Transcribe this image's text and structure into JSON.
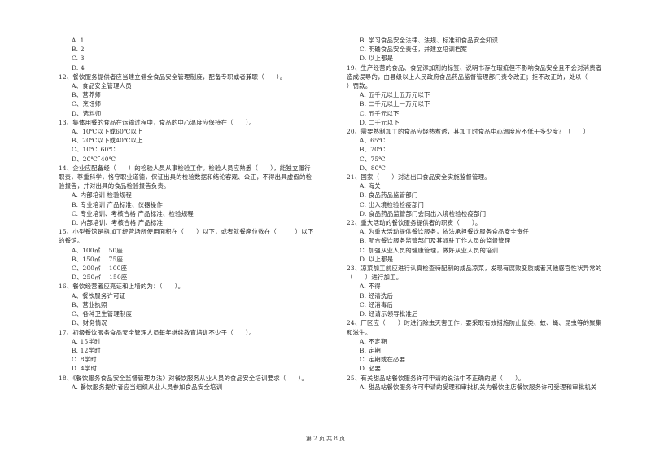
{
  "left_column": [
    {
      "type": "opt",
      "text": "A. 1"
    },
    {
      "type": "opt",
      "text": "B. 2"
    },
    {
      "type": "opt",
      "text": "C. 3"
    },
    {
      "type": "opt",
      "text": "D. 4"
    },
    {
      "type": "q",
      "text": "12、餐饮服务提供者应当建立健全食品安全管理制度，配备专职或者兼职（　　）。"
    },
    {
      "type": "opt",
      "text": "A、食品安全管理人员"
    },
    {
      "type": "opt",
      "text": "B、营养师"
    },
    {
      "type": "opt",
      "text": "C、烹饪师"
    },
    {
      "type": "opt",
      "text": "D、选料师"
    },
    {
      "type": "q",
      "text": "13、集体用餐的食品在运输过程中，食品的中心温度应保持在（　　）。"
    },
    {
      "type": "opt",
      "text": "A、10℃以下或60℃以上"
    },
    {
      "type": "opt",
      "text": "B、20℃以下或40℃以上"
    },
    {
      "type": "opt",
      "text": "C、10℃˜60℃"
    },
    {
      "type": "opt",
      "text": "D、20℃˜40℃"
    },
    {
      "type": "q",
      "text": "14、企业应配备经（　　）的检验人员从事检验工作。检验人员应熟悉（　　），能独立履行"
    },
    {
      "type": "q",
      "text": "职责，尊重科学，恪守职业道德，保证出具的检验数据和结论客观、公正，不得出具虚假的检"
    },
    {
      "type": "q",
      "text": "验报告，并对出具的食品检验报告负责。"
    },
    {
      "type": "opt",
      "text": "A. 内部培训  检验规程"
    },
    {
      "type": "opt",
      "text": "B. 专业培训  产品标准、仪器操作"
    },
    {
      "type": "opt",
      "text": "C. 专业培训、考核合格  产品标准、检验规程"
    },
    {
      "type": "opt",
      "text": "D. 内部培训、考核合格  产品标准"
    },
    {
      "type": "q",
      "text": "15、小型餐馆是指加工经营场所使用面积在（　　）以下，或者就餐座位数在（　　　）以下"
    },
    {
      "type": "q",
      "text": "的餐馆。"
    },
    {
      "type": "opt",
      "text": "A、100㎡　 50座"
    },
    {
      "type": "opt",
      "text": "B、150㎡　 75座"
    },
    {
      "type": "opt",
      "text": "C、200㎡　 100座"
    },
    {
      "type": "opt",
      "text": "D、250㎡　 150座"
    },
    {
      "type": "q",
      "text": "16、餐饮经营者应亮证和上墙的为：（　　）。"
    },
    {
      "type": "opt",
      "text": "A、餐饮服务许可证"
    },
    {
      "type": "opt",
      "text": "B、营业执照"
    },
    {
      "type": "opt",
      "text": "C、各种卫生管理制度"
    },
    {
      "type": "opt",
      "text": "D、财务情况"
    },
    {
      "type": "q",
      "text": "17、初级餐饮服务食品安全管理人员每年继续教育培训不少于（　　）。"
    },
    {
      "type": "opt",
      "text": "A. 15学时"
    },
    {
      "type": "opt",
      "text": "B. 12学时"
    },
    {
      "type": "opt",
      "text": "C. 8学时"
    },
    {
      "type": "opt",
      "text": "D. 4学时"
    },
    {
      "type": "q",
      "text": "18、《餐饮服务食品安全监督管理办法》对餐饮服务从业人员的食品安全培训要求（　　）。"
    },
    {
      "type": "opt",
      "text": "A. 餐饮服务提供者应当组织从业人员参加食品安全培训"
    }
  ],
  "right_column": [
    {
      "type": "opt",
      "text": "B. 学习食品安全法律、法规、标准和食品安全知识"
    },
    {
      "type": "opt",
      "text": "C. 明确食品安全责任，并建立培训档案"
    },
    {
      "type": "opt",
      "text": "D. 以上都是"
    },
    {
      "type": "q",
      "text": "19、生产经营的食品、食品添加剂的标签、说明书存在瑕疵但不影响食品安全且不会对消费者"
    },
    {
      "type": "q",
      "text": "造成误导的，由县级以上人民政府食品药品监督管理部门责令改正；拒不改正的，处以（"
    },
    {
      "type": "q",
      "text": "）罚款。"
    },
    {
      "type": "opt",
      "text": "A. 五千元以上五万元以下"
    },
    {
      "type": "opt",
      "text": "B. 二千元以上一万元以下"
    },
    {
      "type": "opt",
      "text": "C. 五千元以下"
    },
    {
      "type": "opt",
      "text": "D. 二千元以下"
    },
    {
      "type": "q",
      "text": "20、需要熟制加工的食品应烧熟煮透，其加工时食品中心温度应不低于多少度？（　　）"
    },
    {
      "type": "opt",
      "text": "A、65℃"
    },
    {
      "type": "opt",
      "text": "B、70℃"
    },
    {
      "type": "opt",
      "text": "C、75℃"
    },
    {
      "type": "opt",
      "text": "D、80℃"
    },
    {
      "type": "q",
      "text": "21、国家（　　）对进出口食品安全实施监督管理。"
    },
    {
      "type": "opt",
      "text": "A. 海关"
    },
    {
      "type": "opt",
      "text": "B. 食品药品监管部门"
    },
    {
      "type": "opt",
      "text": "C. 出入境检验检疫部门"
    },
    {
      "type": "opt",
      "text": "D. 食品药品监管部门会同出入境检验检疫部门"
    },
    {
      "type": "q",
      "text": "22、重大活动的餐饮服务提供者的职责（　　）。"
    },
    {
      "type": "opt",
      "text": "A. 为重大活动提供餐饮服务，依法承担餐饮服务食品安全责任"
    },
    {
      "type": "opt",
      "text": "B. 配合餐饮服务监管部门及其派驻工作人员的监督管理"
    },
    {
      "type": "opt",
      "text": "C. 加强从业人员的健康管理，做好从业人员的培训"
    },
    {
      "type": "opt",
      "text": "D. 以上都是"
    },
    {
      "type": "q",
      "text": "23、凉菜加工前应进行认真检查待配制的成品凉菜，发现有腐败变质或者其他感官性状异常的"
    },
    {
      "type": "q",
      "text": "（　　）进行加工。"
    },
    {
      "type": "opt",
      "text": "A. 不得"
    },
    {
      "type": "opt",
      "text": "B. 经清洗后"
    },
    {
      "type": "opt",
      "text": "C. 经消毒后"
    },
    {
      "type": "opt",
      "text": "D. 经请示领导批准后"
    },
    {
      "type": "q",
      "text": "24、厂区应（　　）时进行除虫灭害工作，要采取有效措施防止鼠类、蚊、蝇、昆虫等的聚集"
    },
    {
      "type": "q",
      "text": "和滋生。"
    },
    {
      "type": "opt",
      "text": "A. 不定期"
    },
    {
      "type": "opt",
      "text": "B. 定期"
    },
    {
      "type": "opt",
      "text": "C. 定期或在必要"
    },
    {
      "type": "opt",
      "text": "D. 必要"
    },
    {
      "type": "q",
      "text": "25、有关甜品站餐饮服务许可申请的说法中不正确的是（　　）。"
    },
    {
      "type": "opt",
      "text": "A. 甜品站餐饮服务许可申请的受理和审批机关为餐饮主店餐饮服务许可受理和审批机关"
    }
  ],
  "footer": {
    "page_text": "第 2 页 共 8 页"
  }
}
